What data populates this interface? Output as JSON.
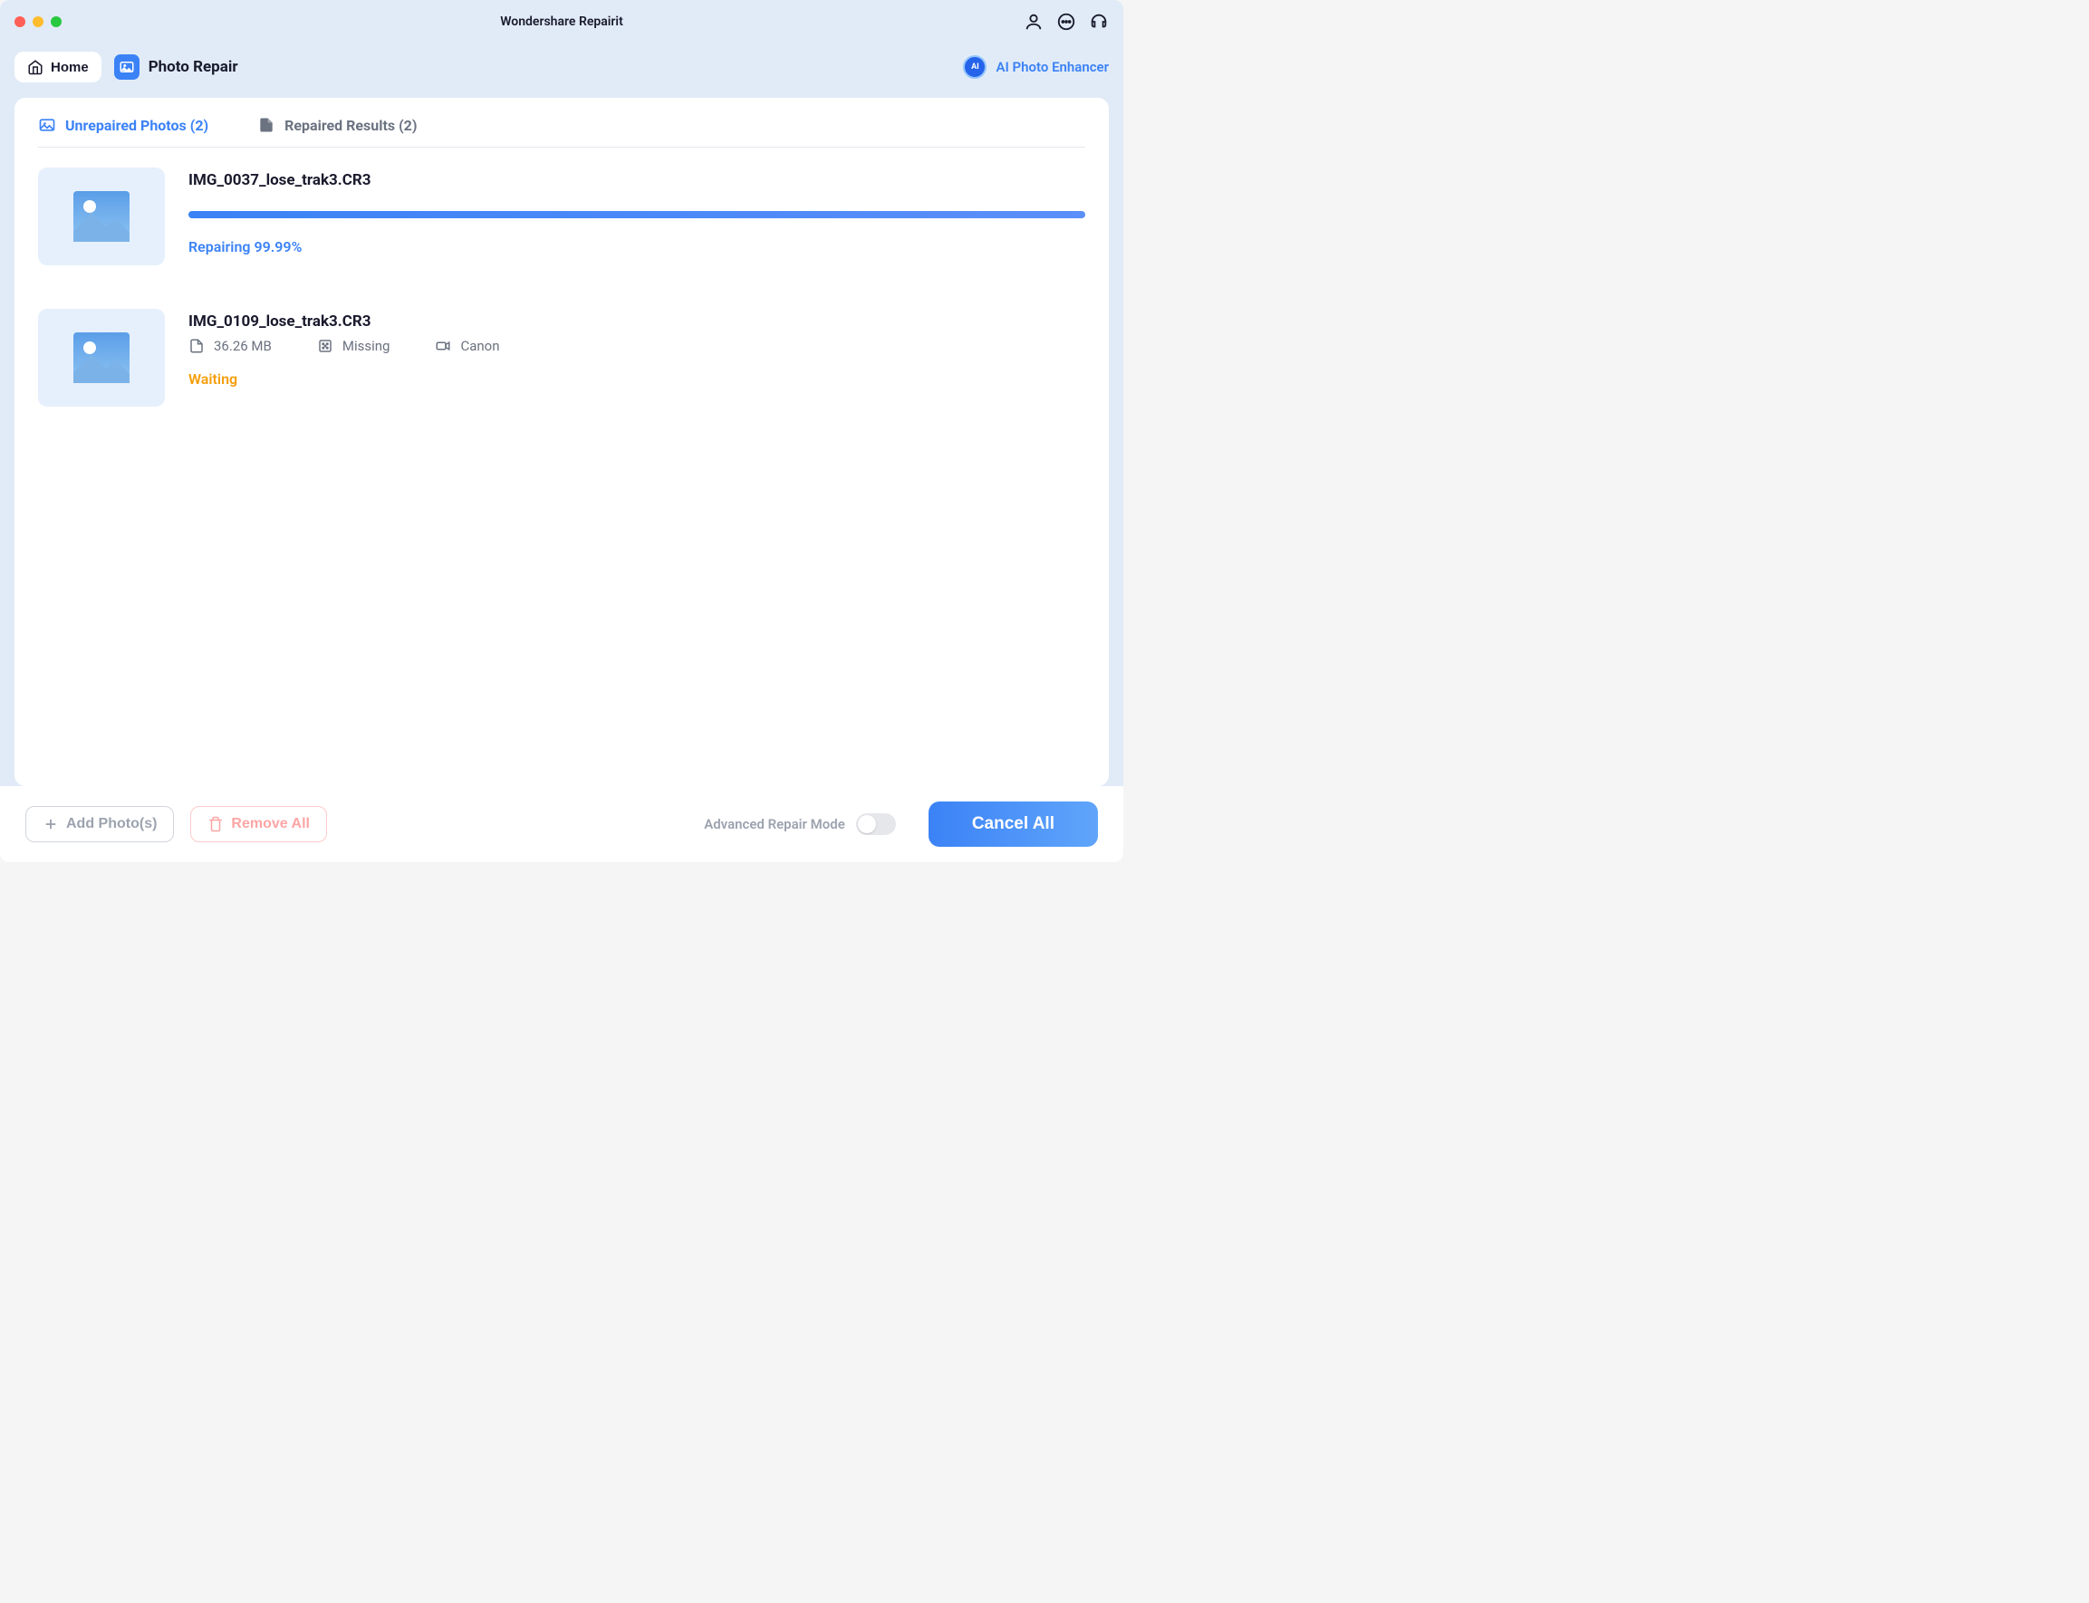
{
  "app_title": "Wondershare Repairit",
  "nav": {
    "home_label": "Home",
    "section_label": "Photo Repair",
    "ai_enhancer_label": "AI Photo Enhancer"
  },
  "tabs": {
    "unrepaired": "Unrepaired Photos (2)",
    "repaired": "Repaired Results (2)"
  },
  "photos": [
    {
      "name": "IMG_0037_lose_trak3.CR3",
      "status_text": "Repairing 99.99%",
      "progress": 100
    },
    {
      "name": "IMG_0109_lose_trak3.CR3",
      "size": "36.26 MB",
      "resolution": "Missing",
      "camera": "Canon",
      "status_text": "Waiting"
    }
  ],
  "footer": {
    "add_label": "Add Photo(s)",
    "remove_label": "Remove All",
    "advanced_label": "Advanced Repair Mode",
    "cancel_label": "Cancel All"
  }
}
